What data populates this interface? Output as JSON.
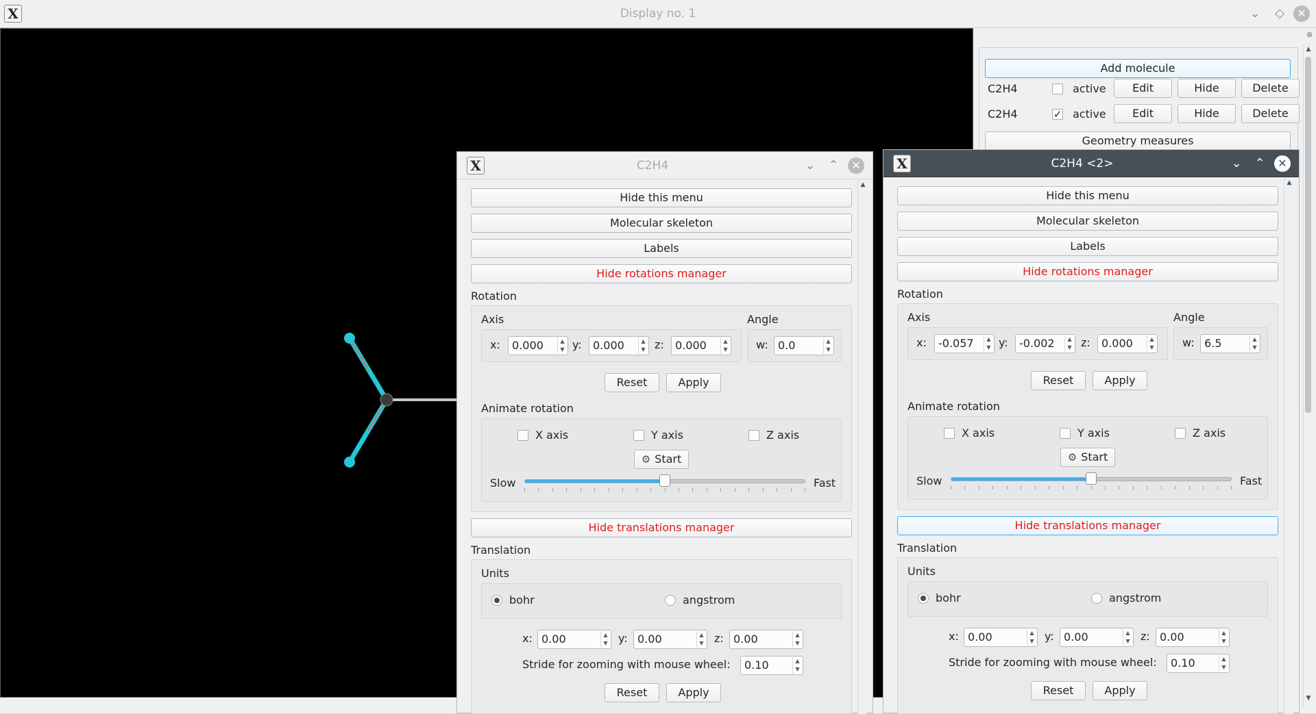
{
  "window": {
    "title": "Display no. 1"
  },
  "panel": {
    "add_molecule": "Add molecule",
    "molecules": [
      {
        "name": "C2H4",
        "active_label": "active",
        "active": false,
        "edit": "Edit",
        "hide": "Hide",
        "delete": "Delete"
      },
      {
        "name": "C2H4",
        "active_label": "active",
        "active": true,
        "edit": "Edit",
        "hide": "Hide",
        "delete": "Delete"
      }
    ],
    "geometry_measures": "Geometry measures"
  },
  "editors": [
    {
      "title": "C2H4",
      "hide_menu": "Hide this menu",
      "skeleton": "Molecular skeleton",
      "labels": "Labels",
      "hide_rotations": "Hide rotations manager",
      "rotation_title": "Rotation",
      "axis_title": "Axis",
      "angle_title": "Angle",
      "axis_x_label": "x:",
      "axis_y_label": "y:",
      "axis_z_label": "z:",
      "angle_w_label": "w:",
      "axis_x": "0.000",
      "axis_y": "0.000",
      "axis_z": "0.000",
      "angle_w": "0.0",
      "reset": "Reset",
      "apply": "Apply",
      "animate_title": "Animate rotation",
      "x_axis": "X axis",
      "y_axis": "Y axis",
      "z_axis": "Z axis",
      "start": "Start",
      "slow": "Slow",
      "fast": "Fast",
      "speed": 0.5,
      "hide_translations": "Hide translations manager",
      "translation_title": "Translation",
      "units_title": "Units",
      "bohr": "bohr",
      "angstrom": "angstrom",
      "tr_x_label": "x:",
      "tr_y_label": "y:",
      "tr_z_label": "z:",
      "tr_x": "0.00",
      "tr_y": "0.00",
      "tr_z": "0.00",
      "stride_label": "Stride for zooming with mouse wheel:",
      "stride": "0.10",
      "tr_reset": "Reset",
      "tr_apply": "Apply"
    },
    {
      "title": "C2H4 <2>",
      "hide_menu": "Hide this menu",
      "skeleton": "Molecular skeleton",
      "labels": "Labels",
      "hide_rotations": "Hide rotations manager",
      "rotation_title": "Rotation",
      "axis_title": "Axis",
      "angle_title": "Angle",
      "axis_x_label": "x:",
      "axis_y_label": "y:",
      "axis_z_label": "z:",
      "angle_w_label": "w:",
      "axis_x": "-0.057",
      "axis_y": "-0.002",
      "axis_z": "0.000",
      "angle_w": "6.5",
      "reset": "Reset",
      "apply": "Apply",
      "animate_title": "Animate rotation",
      "x_axis": "X axis",
      "y_axis": "Y axis",
      "z_axis": "Z axis",
      "start": "Start",
      "slow": "Slow",
      "fast": "Fast",
      "speed": 0.5,
      "hide_translations": "Hide translations manager",
      "translation_title": "Translation",
      "units_title": "Units",
      "bohr": "bohr",
      "angstrom": "angstrom",
      "tr_x_label": "x:",
      "tr_y_label": "y:",
      "tr_z_label": "z:",
      "tr_x": "0.00",
      "tr_y": "0.00",
      "tr_z": "0.00",
      "stride_label": "Stride for zooming with mouse wheel:",
      "stride": "0.10",
      "tr_reset": "Reset",
      "tr_apply": "Apply"
    }
  ],
  "colors": {
    "hydrogen": "#22c8d6",
    "carbon": "#3a3a3a",
    "accent": "#3daee9",
    "warning_text": "#e11c1c"
  },
  "icons": {
    "app": "x-window-logo-icon",
    "start": "gear-icon"
  }
}
